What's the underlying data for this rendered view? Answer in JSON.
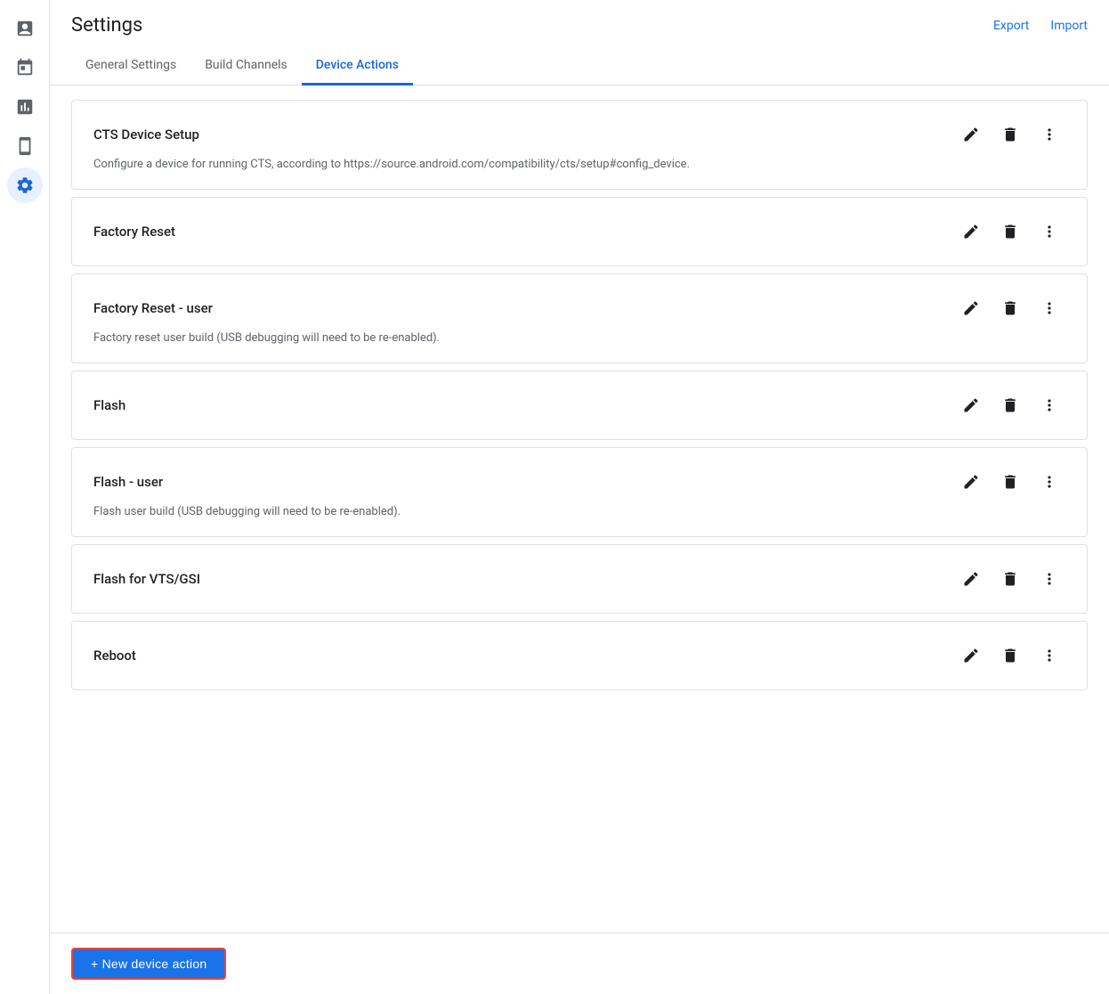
{
  "header": {
    "title": "Settings",
    "export_label": "Export",
    "import_label": "Import"
  },
  "tabs": [
    {
      "id": "general",
      "label": "General Settings",
      "active": false
    },
    {
      "id": "build-channels",
      "label": "Build Channels",
      "active": false
    },
    {
      "id": "device-actions",
      "label": "Device Actions",
      "active": true
    }
  ],
  "sidebar": {
    "items": [
      {
        "id": "reports",
        "icon": "report-icon"
      },
      {
        "id": "calendar",
        "icon": "calendar-icon"
      },
      {
        "id": "analytics",
        "icon": "analytics-icon"
      },
      {
        "id": "device",
        "icon": "device-icon"
      },
      {
        "id": "settings",
        "icon": "settings-icon",
        "active": true
      }
    ]
  },
  "actions": [
    {
      "id": "cts-device-setup",
      "title": "CTS Device Setup",
      "description": "Configure a device for running CTS, according to https://source.android.com/compatibility/cts/setup#config_device."
    },
    {
      "id": "factory-reset",
      "title": "Factory Reset",
      "description": ""
    },
    {
      "id": "factory-reset-user",
      "title": "Factory Reset - user",
      "description": "Factory reset user build (USB debugging will need to be re-enabled)."
    },
    {
      "id": "flash",
      "title": "Flash",
      "description": ""
    },
    {
      "id": "flash-user",
      "title": "Flash - user",
      "description": "Flash user build (USB debugging will need to be re-enabled)."
    },
    {
      "id": "flash-vts-gsi",
      "title": "Flash for VTS/GSI",
      "description": ""
    },
    {
      "id": "reboot",
      "title": "Reboot",
      "description": ""
    }
  ],
  "footer": {
    "new_action_label": "+ New device action"
  }
}
